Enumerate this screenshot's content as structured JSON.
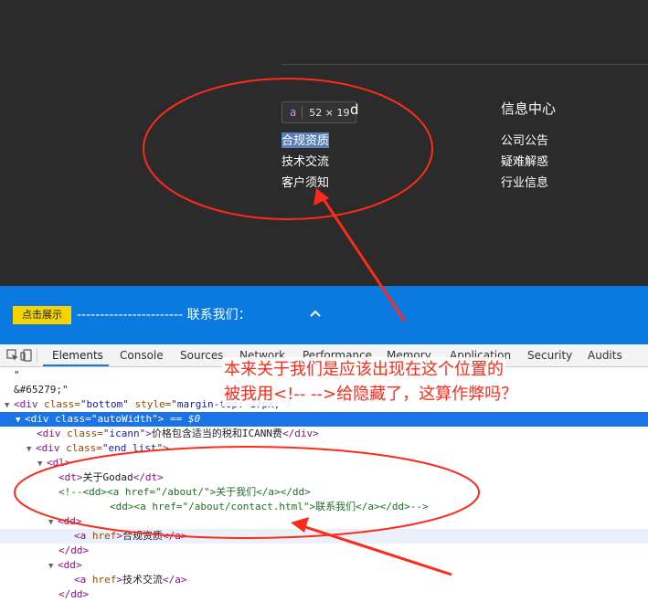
{
  "footer": {
    "tooltip": {
      "tag": "a",
      "size": "52 × 19"
    },
    "tooltip_tail": "d",
    "about_col": {
      "links": [
        "合规资质",
        "技术交流",
        "客户须知"
      ]
    },
    "info_col": {
      "heading": "信息中心",
      "links": [
        "公司公告",
        "疑难解惑",
        "行业信息"
      ]
    }
  },
  "bluebar": {
    "show_button": "点击展示",
    "contact_text": "----------------------- 联系我们：",
    "caret_icon": "chevron-up-icon",
    "color": "#0a7ae0"
  },
  "devtools": {
    "inspect_icon": "inspect-cursor-icon",
    "device_icon": "device-toggle-icon",
    "tabs": [
      "Elements",
      "Console",
      "Sources",
      "Network",
      "Performance",
      "Memory",
      "Application",
      "Security",
      "Audits"
    ],
    "active_tab": "Elements",
    "dom": {
      "l0": "\"",
      "l1": "&#65279;\"",
      "l2_tag_open": "<div ",
      "l2_attr1": "class=",
      "l2_val1": "\"bottom\"",
      "l2_attr2": " style=",
      "l2_val2": "\"margin-top:-17px;\"",
      "l2_tag_close": ">",
      "l3_tag_open": "<div ",
      "l3_attr": "class=",
      "l3_val": "\"autoWidth\"",
      "l3_tag_close": ">",
      "l3_eq": " == $0",
      "l4_tag_open": "<div ",
      "l4_attr": "class=",
      "l4_val": "\"icann\"",
      "l4_tag_close": ">",
      "l4_text": "价格包含适当的税和ICANN费",
      "l4_end": "</div>",
      "l5_tag_open": "<div ",
      "l5_attr": "class=",
      "l5_val": "\"end_list\"",
      "l5_tag_close": ">",
      "l6": "<dl>",
      "l7_open": "<dt>",
      "l7_text": "关于Godad",
      "l7_close": "</dt>",
      "l8": "<!--<dd><a href=\"/about/\">关于我们</a></dd>",
      "l9": "<dd><a href=\"/about/contact.html\">联系我们</a></dd>-->",
      "l10": "<dd>",
      "l11_open": "<a ",
      "l11_attr": "href",
      "l11_close": ">",
      "l11_text": "合规资质",
      "l11_end": "</a>",
      "l12": "</dd>",
      "l13": "<dd>",
      "l14_open": "<a ",
      "l14_attr": "href",
      "l14_close": ">",
      "l14_text": "技术交流",
      "l14_end": "</a>",
      "l15": "</dd>"
    }
  },
  "annotation": {
    "line1": "本来关于我们是应该出现在这个位置的",
    "line2": "被我用<!-- -->给隐藏了，这算作弊吗？",
    "color": "#ff2a1a"
  }
}
